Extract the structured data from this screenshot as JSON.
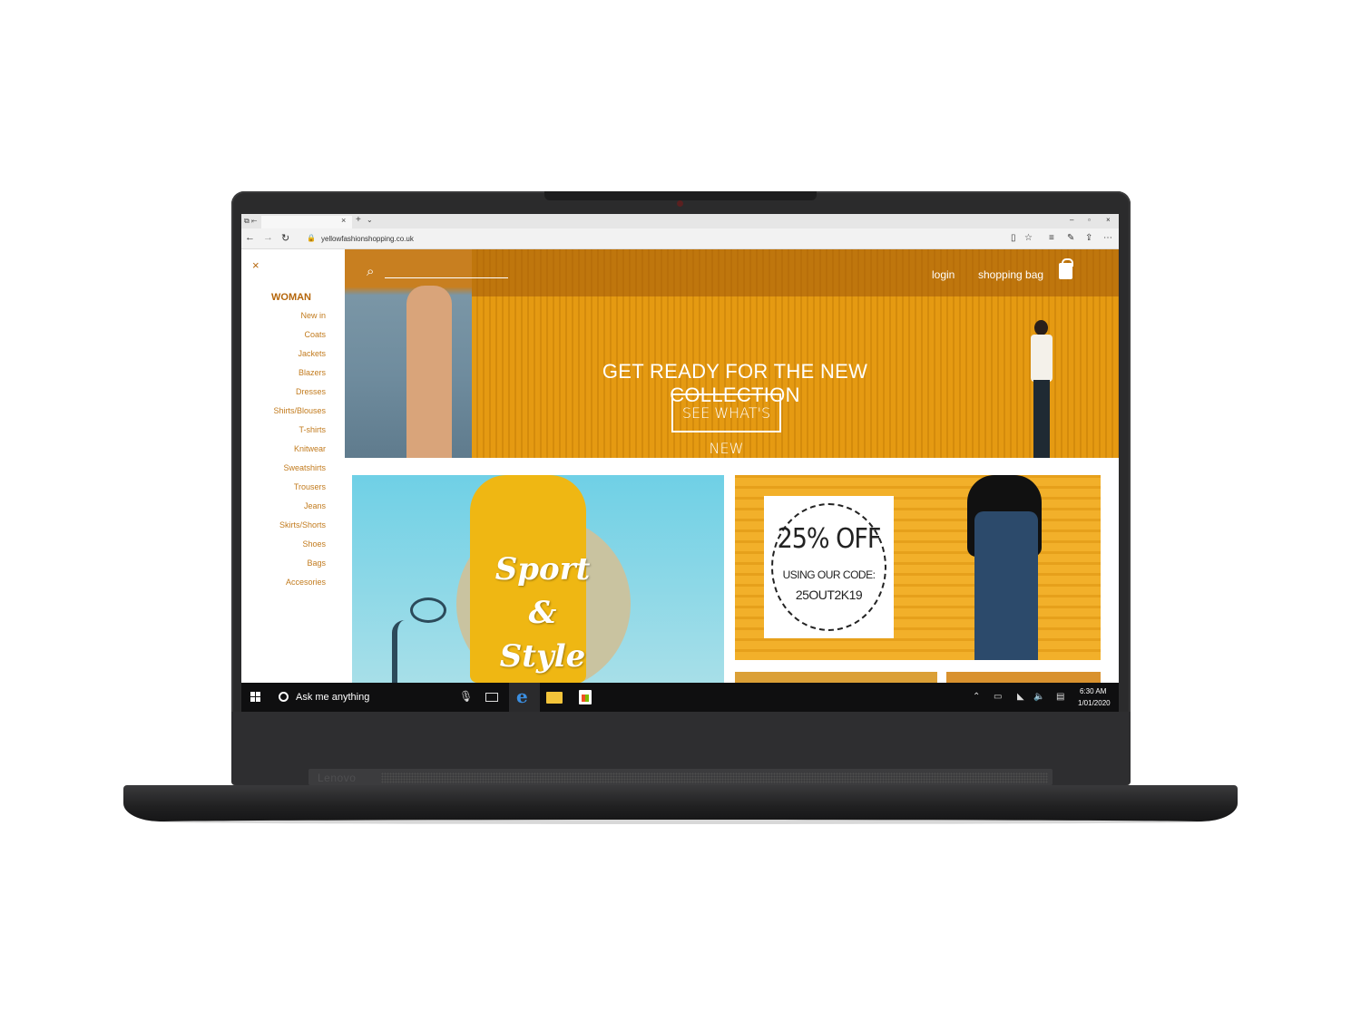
{
  "browser": {
    "url": "yellowfashionshopping.co.uk",
    "tab_close": "×",
    "tab_new": "+",
    "tab_list": "⌄",
    "window_controls": [
      "–",
      "▫",
      "×"
    ],
    "nav": {
      "back": "←",
      "forward": "→",
      "refresh": "↻"
    },
    "toolbar_icons": [
      "reading-view-icon",
      "favorite-star-icon",
      "hub-icon",
      "web-note-icon",
      "share-icon",
      "more-icon"
    ]
  },
  "sidebar": {
    "close": "×",
    "heading": "WOMAN",
    "items": [
      "New in",
      "Coats",
      "Jackets",
      "Blazers",
      "Dresses",
      "Shirts/Blouses",
      "T-shirts",
      "Knitwear",
      "Sweatshirts",
      "Trousers",
      "Jeans",
      "Skirts/Shorts",
      "Shoes",
      "Bags",
      "Accesories"
    ]
  },
  "hero": {
    "login": "login",
    "shopping_bag": "shopping bag",
    "headline": "GET READY FOR THE NEW COLLECTION",
    "cta": "SEE WHAT'S NEW"
  },
  "cards": {
    "sport_line1": "Sport",
    "sport_line2": "&",
    "sport_line3": "Style",
    "promo_off": "25% OFF",
    "promo_using": "USING OUR CODE:",
    "promo_code": "25OUT2K19"
  },
  "taskbar": {
    "search_placeholder": "Ask me anything",
    "time": "6:30 AM",
    "date": "1/01/2020",
    "tray_icons": [
      "chevron-up-icon",
      "battery-icon",
      "network-icon",
      "volume-icon",
      "action-center-icon"
    ]
  },
  "device": {
    "brand": "Lenovo"
  },
  "colors": {
    "brand_orange": "#e59a12",
    "sidebar_text": "#c27b1e",
    "taskbar": "#0f0f10",
    "edge_blue": "#3b8ee0"
  }
}
